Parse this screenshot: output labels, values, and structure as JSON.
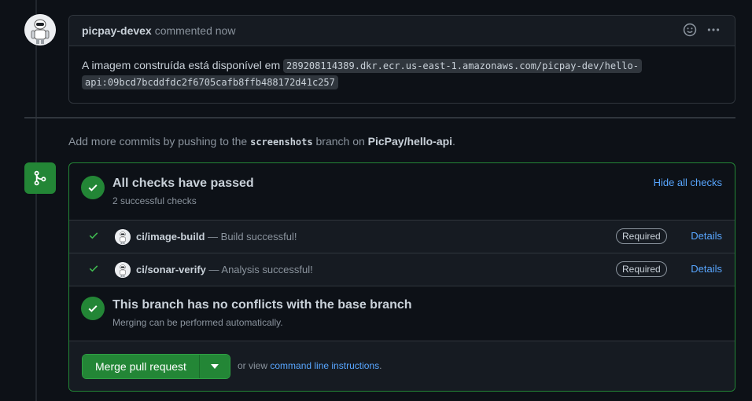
{
  "comment": {
    "author": "picpay-devex",
    "action": "commented now",
    "body_text": "A imagem construída está disponível em ",
    "image_ref_line1": "289208114389.dkr.ecr.us-east-1.amazonaws.com/picpay-dev/hello-",
    "image_ref_line2": "api:09bcd7bcddfdc2f6705cafb8ffb488172d41c257",
    "icons": [
      "smiley-icon",
      "kebab-horizontal-icon"
    ]
  },
  "hint": {
    "prefix": "Add more commits by pushing to the",
    "branch": "screenshots",
    "middle": "branch on",
    "repo": "PicPay/hello-api",
    "suffix": "."
  },
  "checks": {
    "title": "All checks have passed",
    "subtitle": "2 successful checks",
    "toggle_label": "Hide all checks",
    "items": [
      {
        "name": "ci/image-build",
        "status": "— Build successful!",
        "badge": "Required",
        "link": "Details"
      },
      {
        "name": "ci/sonar-verify",
        "status": "— Analysis successful!",
        "badge": "Required",
        "link": "Details"
      }
    ]
  },
  "conflicts": {
    "title": "This branch has no conflicts with the base branch",
    "subtitle": "Merging can be performed automatically."
  },
  "merge": {
    "button_label": "Merge pull request",
    "or_view": "or view",
    "cli_link": "command line instructions",
    "cli_suffix": "."
  },
  "colors": {
    "success": "#238636",
    "link": "#58a6ff",
    "background": "#0d1117"
  }
}
